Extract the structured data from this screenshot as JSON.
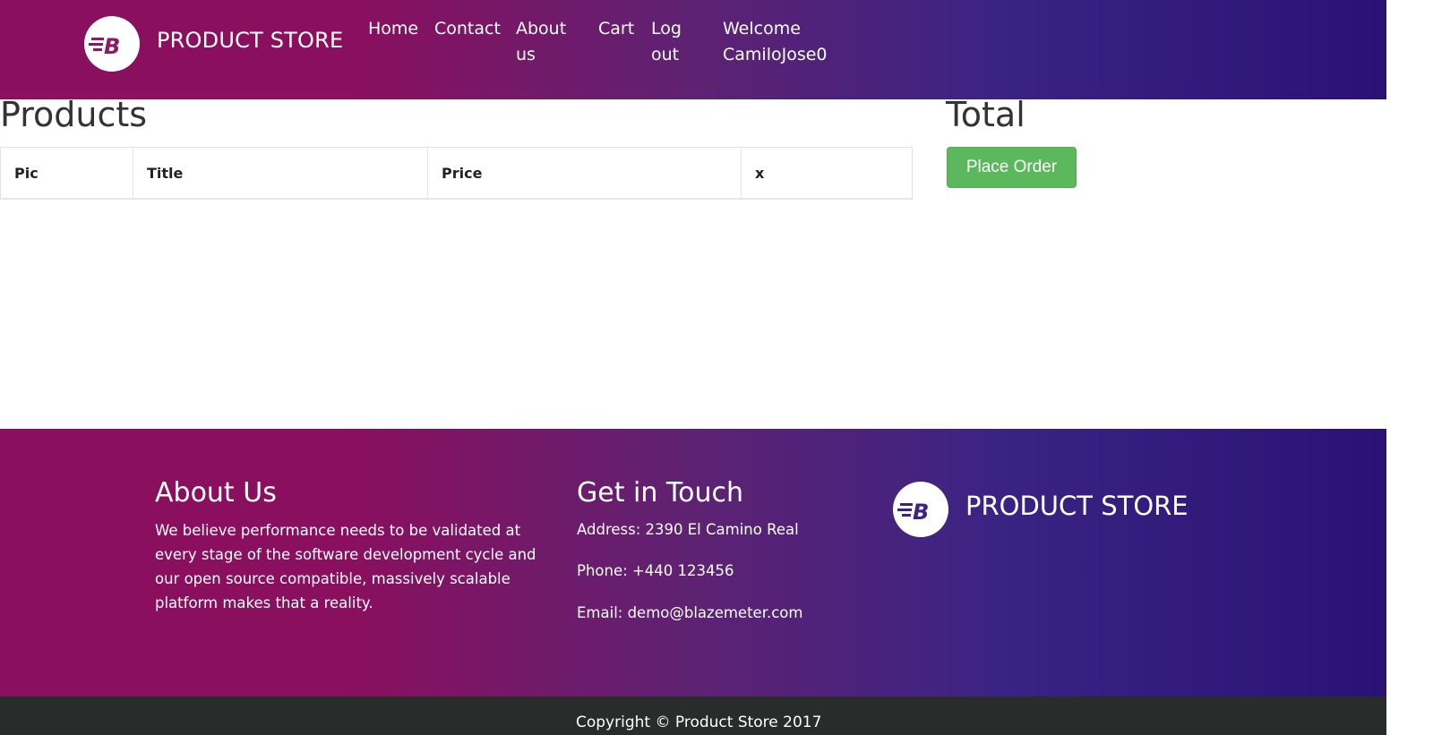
{
  "navbar": {
    "brand": "PRODUCT STORE",
    "links": {
      "home": "Home",
      "contact": "Contact",
      "about": "About us",
      "cart": "Cart",
      "logout": "Log out",
      "welcome": "Welcome CamiloJose0"
    }
  },
  "main": {
    "products_heading": "Products",
    "table_headers": [
      "Pic",
      "Title",
      "Price",
      "x"
    ],
    "total_heading": "Total",
    "place_order_label": "Place Order"
  },
  "footer": {
    "about_heading": "About Us",
    "about_text": "We believe performance needs to be validated at every stage of the software development cycle and our open source compatible, massively scalable platform makes that a reality.",
    "touch_heading": "Get in Touch",
    "address": "Address: 2390 El Camino Real",
    "phone": "Phone: +440 123456",
    "email": "Email: demo@blazemeter.com",
    "brand": "PRODUCT STORE"
  },
  "copyright": "Copyright © Product Store 2017",
  "icons": {
    "logo": "blazemeter-logo-icon"
  },
  "colors": {
    "gradient_start": "#8a0f5e",
    "gradient_end": "#2a1173",
    "place_order": "#5cb85c",
    "copyright_bar": "#2a2b2b"
  }
}
